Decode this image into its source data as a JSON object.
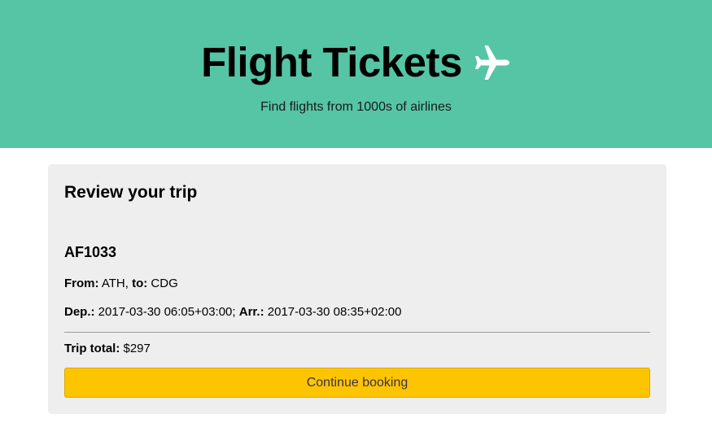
{
  "header": {
    "title": "Flight Tickets",
    "icon": "airplane-icon",
    "subtitle": "Find flights from 1000s of airlines",
    "background_color": "#55c5a6"
  },
  "review": {
    "heading": "Review your trip",
    "flight_number": "AF1033",
    "from_label": "From:",
    "from_value": "ATH",
    "to_label": "to:",
    "to_value": "CDG",
    "dep_label": "Dep.:",
    "dep_value": "2017-03-30 06:05+03:00",
    "arr_label": "Arr.:",
    "arr_value": "2017-03-30 08:35+02:00",
    "total_label": "Trip total:",
    "total_value": "$297",
    "continue_label": "Continue booking",
    "button_color": "#fdc500"
  }
}
